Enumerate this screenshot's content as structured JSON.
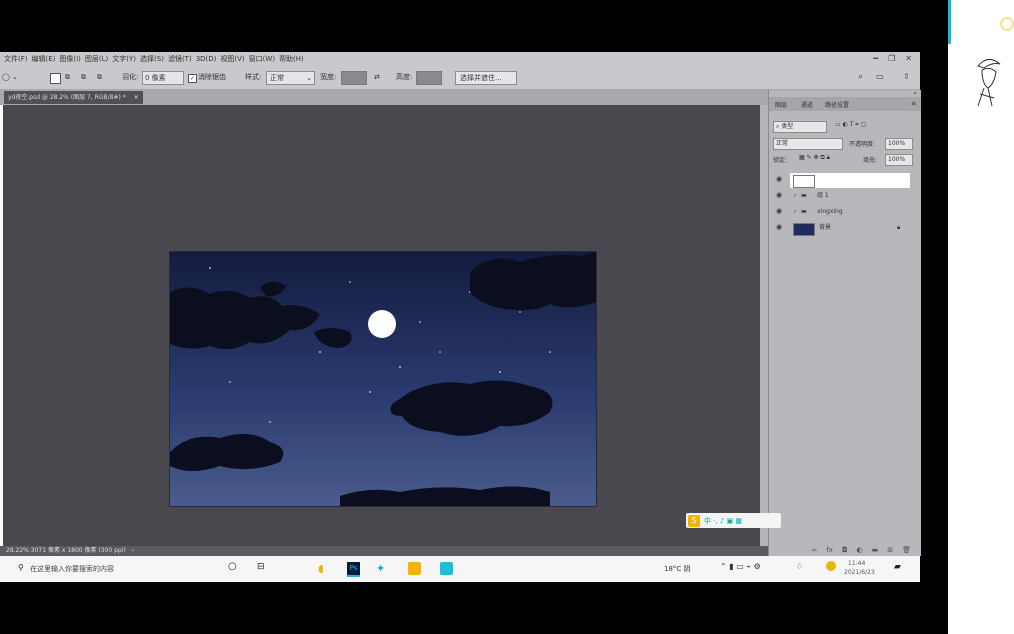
{
  "menubar": {
    "items": [
      "文件(F)",
      "编辑(E)",
      "图像(I)",
      "图层(L)",
      "文字(Y)",
      "选择(S)",
      "滤镜(T)",
      "3D(D)",
      "视图(V)",
      "窗口(W)",
      "帮助(H)"
    ]
  },
  "options": {
    "feather_label": "羽化:",
    "feather_value": "0 像素",
    "antialias_label": "消除锯齿",
    "style_label": "样式:",
    "style_value": "正常",
    "width_label": "宽度:",
    "height_label": "高度:",
    "select_mask_button": "选择并遮住..."
  },
  "document": {
    "tab_title": "yd夜空.psd @ 28.2% (图层 7, RGB/8#) *",
    "status": "28.22%   3071 像素 x 1800 像素 (300 ppi)"
  },
  "panel": {
    "tabs": [
      "图层",
      "通道",
      "路径设置"
    ],
    "filter_kind": "类型",
    "blend_mode": "正常",
    "opacity_label": "不透明度:",
    "opacity_value": "100%",
    "lock_label": "锁定:",
    "fill_label": "填充:",
    "fill_value": "100%",
    "layers": [
      {
        "name": ""
      },
      {
        "name": "组 1"
      },
      {
        "name": "xingxing"
      },
      {
        "name": "背景"
      }
    ]
  },
  "taskbar": {
    "search_placeholder": "在这里输入你要搜索的内容",
    "weather": "18°C 阴",
    "time": "11:44",
    "date": "2021/6/23"
  },
  "colors": {
    "canvas_bg": "#4a484f",
    "chrome": "#c9c8cc",
    "panel": "#b8b7bb",
    "accent": "#1bb7d8"
  }
}
